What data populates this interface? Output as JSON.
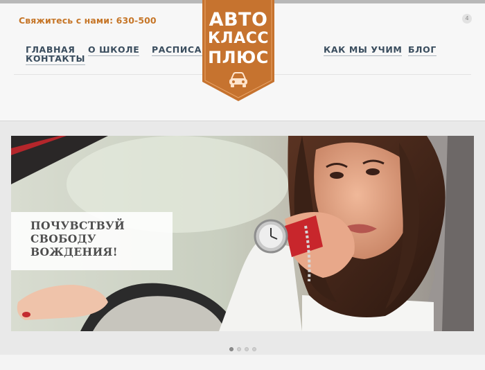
{
  "header": {
    "contact": "Свяжитесь с нами: 630-500",
    "cart_count": "4"
  },
  "nav": {
    "home": "ГЛАВНАЯ",
    "contacts": "КОНТАКТЫ",
    "about": "О ШКОЛЕ",
    "schedule": "РАСПИСАНИЕ",
    "how_we_teach": "КАК МЫ УЧИМ",
    "blog": "БЛОГ"
  },
  "logo": {
    "line1": "АВТО",
    "line2": "КЛАСС",
    "line3": "ПЛЮС",
    "icon": "car-icon",
    "color": "#c6732f"
  },
  "slider": {
    "slogan": "ПОЧУВСТВУЙ\nСВОБОДУ\nВОЖДЕНИЯ!",
    "slide_count": 4,
    "active_slide": 1
  },
  "colors": {
    "accent": "#c67628",
    "nav_text": "#3a4d5e"
  }
}
